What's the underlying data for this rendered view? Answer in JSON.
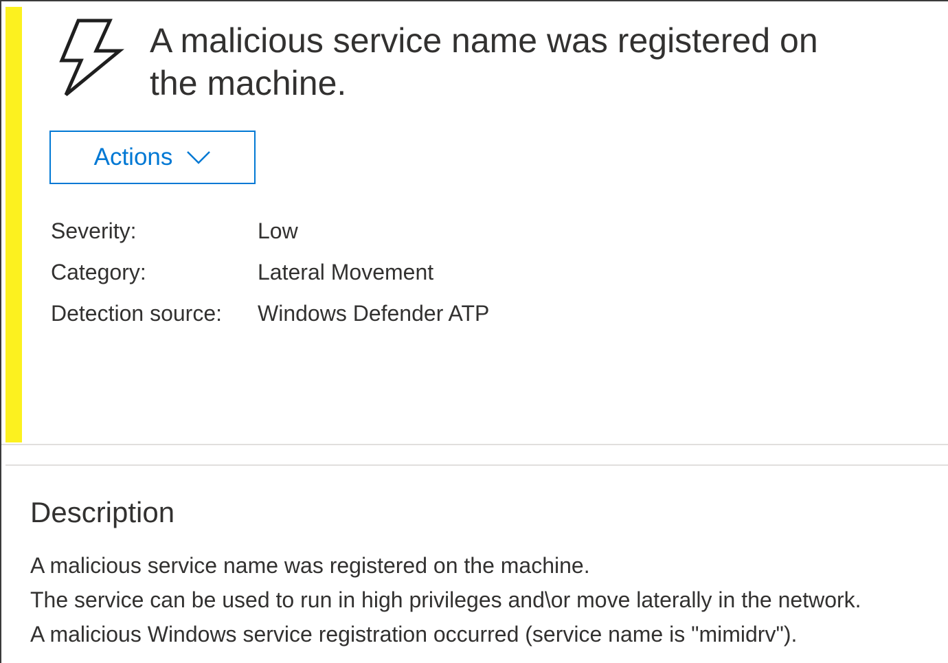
{
  "alert": {
    "title": "A malicious service name was registered on the machine.",
    "icon": "lightning-bolt-icon",
    "severity_color": "#fcf11f",
    "actions_label": "Actions",
    "properties": [
      {
        "label": "Severity:",
        "value": "Low"
      },
      {
        "label": "Category:",
        "value": "Lateral Movement"
      },
      {
        "label": "Detection source:",
        "value": "Windows Defender ATP"
      }
    ]
  },
  "description": {
    "heading": "Description",
    "lines": [
      "A malicious service name was registered on the machine.",
      "The service can be used to run in high privileges and\\or move laterally in the network.",
      "A malicious Windows service registration occurred (service name is \"mimidrv\")."
    ]
  },
  "colors": {
    "accent": "#0078d4",
    "severity_low": "#fcf11f",
    "text": "#323130"
  }
}
